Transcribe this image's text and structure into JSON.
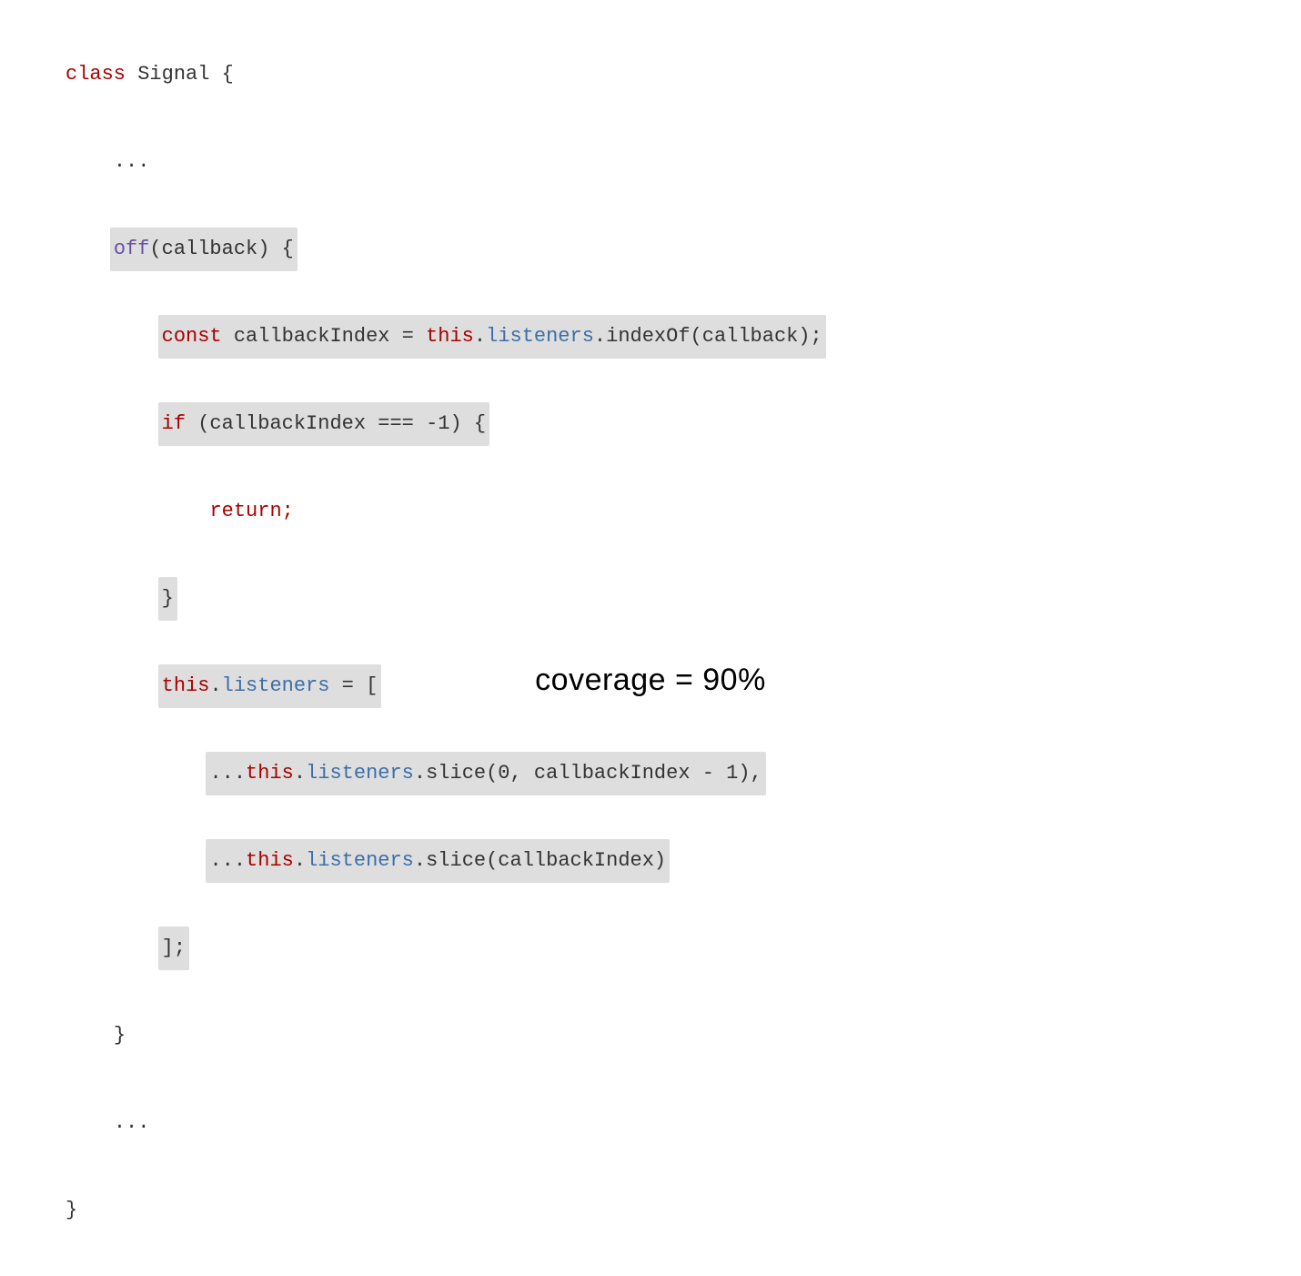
{
  "code": {
    "ln1": {
      "class": "class",
      "Signal": "Signal",
      "brace": " {"
    },
    "ln2": {
      "dots": "..."
    },
    "ln3": {
      "off": "off",
      "rest": "(callback) {"
    },
    "ln4": {
      "const": "const",
      "mid": " callbackIndex = ",
      "this": "this",
      "dot": ".",
      "listeners": "listeners",
      "tail": ".indexOf(callback);"
    },
    "ln5": {
      "if": "if",
      "rest": " (callbackIndex === -1) {"
    },
    "ln6": {
      "return": "return;"
    },
    "ln7": {
      "brace": "}"
    },
    "ln8": {
      "this": "this",
      "dot": ".",
      "listeners": "listeners",
      "rest": " = ["
    },
    "ln9": {
      "spread": "...",
      "this": "this",
      "dot": ".",
      "listeners": "listeners",
      "tail": ".slice(0, callbackIndex - 1),"
    },
    "ln10": {
      "spread": "...",
      "this": "this",
      "dot": ".",
      "listeners": "listeners",
      "tail": ".slice(callbackIndex)"
    },
    "ln11": {
      "close": "];"
    },
    "ln12": {
      "brace": "}"
    },
    "ln13": {
      "dots": "..."
    },
    "ln14": {
      "brace": "}"
    }
  },
  "caption": "coverage = 90%"
}
